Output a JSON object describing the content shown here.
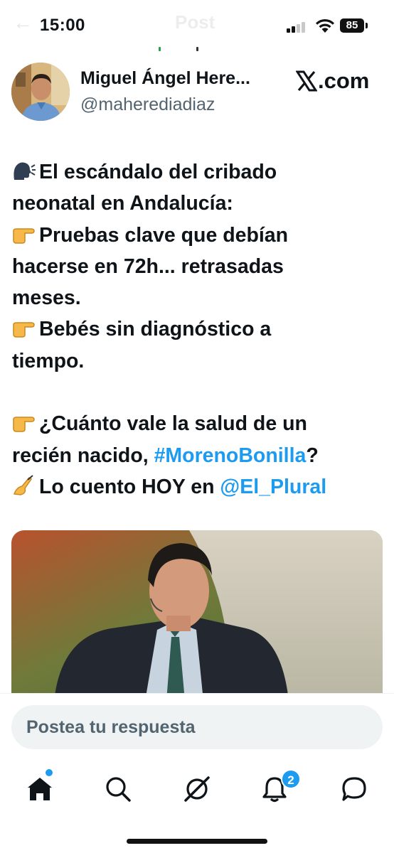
{
  "status_bar": {
    "time": "15:00",
    "battery": "85",
    "faded_title": "Post",
    "faded_back": "←"
  },
  "tweet": {
    "author_name": "Miguel Ángel Here...",
    "author_handle": "@maherediadiaz",
    "source_label": ".com",
    "lines": {
      "l1": "El escándalo del cribado",
      "l2": "neonatal en Andalucía:",
      "l3": "Pruebas clave que debían",
      "l4": "hacerse en 72h... retrasadas",
      "l5": "meses.",
      "l6": "Bebés sin diagnóstico a",
      "l7": "tiempo.",
      "l8": "¿Cuánto vale la salud de un",
      "l9a": "recién nacido, ",
      "l9_hashtag": "#MorenoBonilla",
      "l9b": "?",
      "l10a": "Lo cuento HOY en ",
      "l10_mention": "@El_Plural"
    },
    "icons": [
      "speaking-head-icon",
      "pointing-right-icon",
      "writing-hand-icon"
    ],
    "link_color": "#1d9bf0"
  },
  "reply": {
    "placeholder": "Postea tu respuesta"
  },
  "nav": {
    "items": [
      "home-icon",
      "search-icon",
      "grok-icon",
      "notifications-icon",
      "messages-icon"
    ],
    "notification_count": "2",
    "accent": "#1d9bf0"
  }
}
